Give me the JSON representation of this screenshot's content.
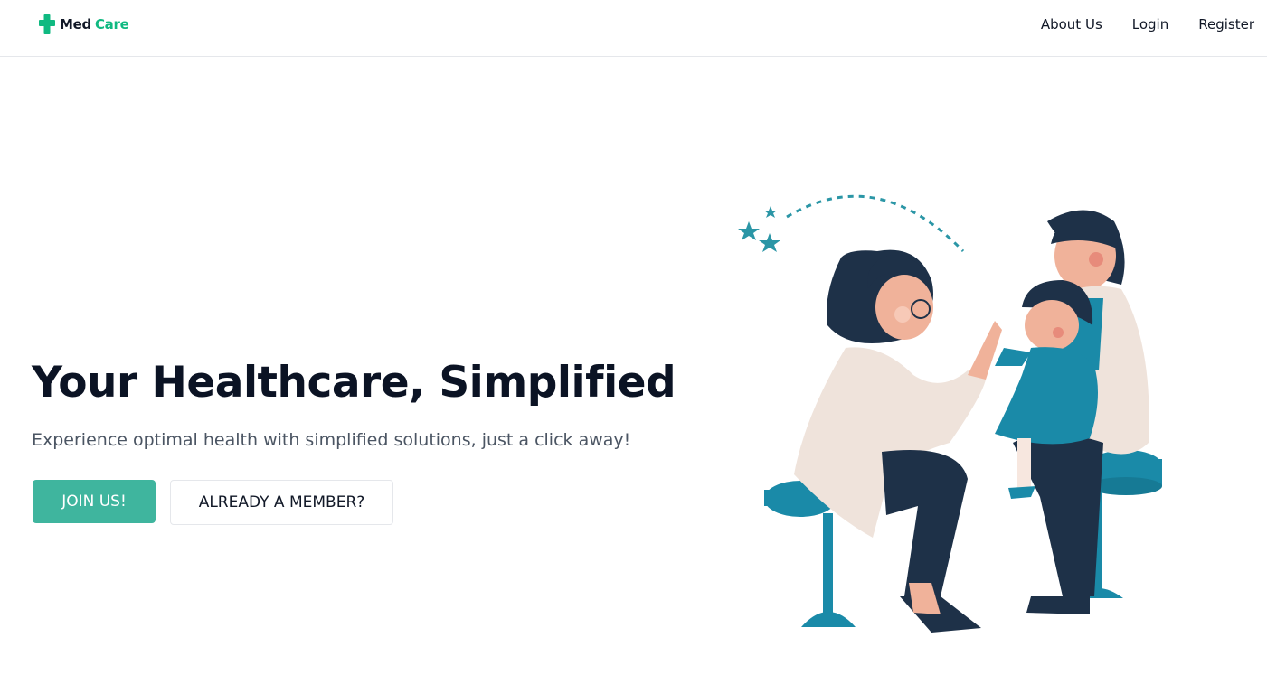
{
  "brand": {
    "name_part1": "Med",
    "name_part2": "Care",
    "accent": "#10b981",
    "icon": "medical-cross-icon"
  },
  "nav": {
    "links": [
      "About Us",
      "Login",
      "Register"
    ]
  },
  "hero": {
    "title": "Your Healthcare, Simplified",
    "subtitle": "Experience optimal health with simplified solutions, just a click away!",
    "primary_button": "JOIN US!",
    "secondary_button": "ALREADY A MEMBER?"
  },
  "colors": {
    "primary_button": "#3fb59e",
    "teal_illustration": "#1a8aa8",
    "navy": "#1e3148"
  }
}
